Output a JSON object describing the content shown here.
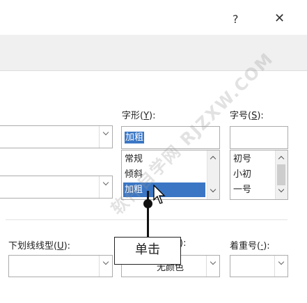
{
  "titlebar": {
    "help": "?",
    "close": "✕"
  },
  "font_style": {
    "label": "字形(",
    "key": "Y",
    "label_end": "):",
    "value": "加粗",
    "items": [
      "常规",
      "倾斜",
      "加粗"
    ],
    "selected_index": 2
  },
  "font_size": {
    "label": "字号(",
    "key": "S",
    "label_end": "):",
    "value": "",
    "items": [
      "初号",
      "小初",
      "一号"
    ]
  },
  "underline_type": {
    "label": "下划线线型(",
    "key": "U",
    "label_end": "):",
    "value": ""
  },
  "underline_color": {
    "label_end": "):",
    "value": "无颜色"
  },
  "emphasis": {
    "label": "着重号(",
    "key": "·",
    "label_end": "):",
    "value": ""
  },
  "callout": {
    "text": "单击"
  },
  "watermark": {
    "text": "软件自学网 RJZXW.COM"
  }
}
